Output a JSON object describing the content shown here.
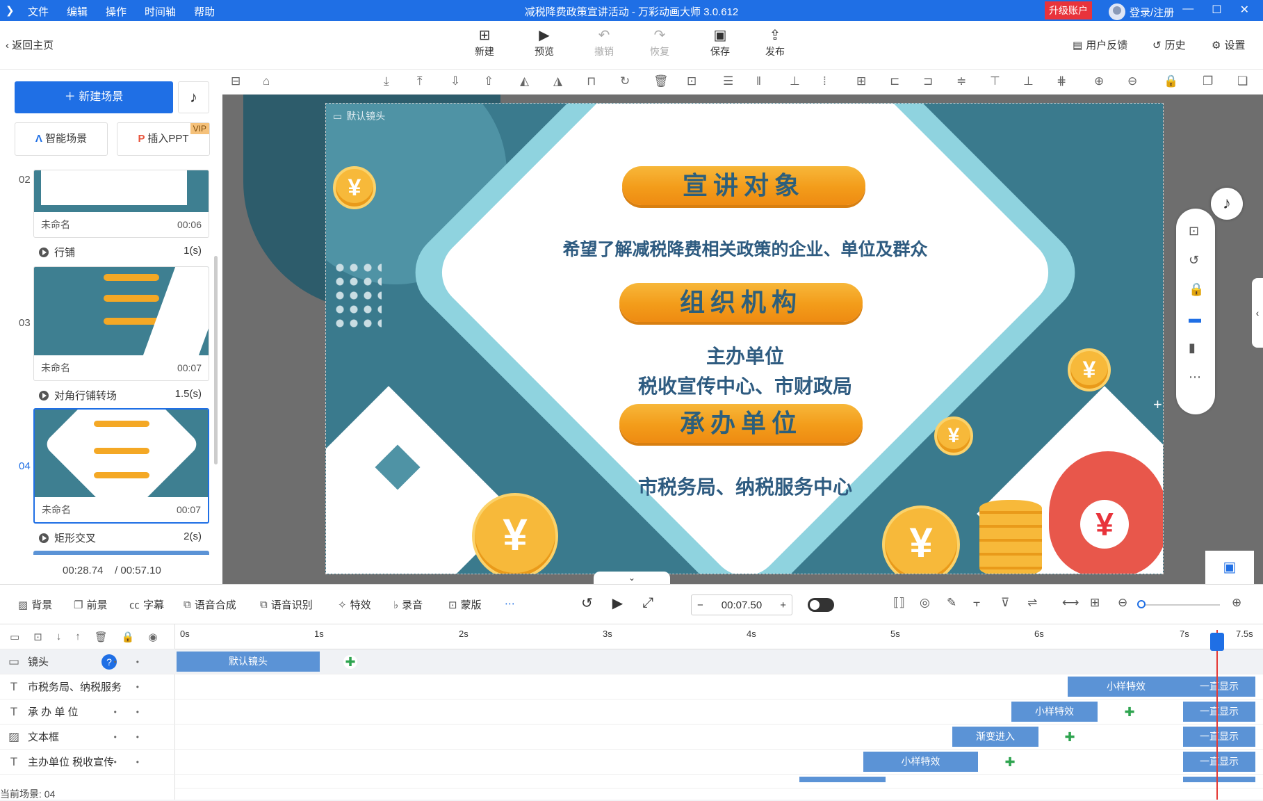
{
  "titlebar": {
    "menus": [
      "文件",
      "编辑",
      "操作",
      "时间轴",
      "帮助"
    ],
    "title": "减税降费政策宣讲活动 - 万彩动画大师 3.0.612",
    "upgrade": "升级账户",
    "login": "登录/注册"
  },
  "toolbar": {
    "back": "返回主页",
    "new": "新建",
    "preview": "预览",
    "undo": "撤销",
    "redo": "恢复",
    "save": "保存",
    "publish": "发布",
    "feedback": "用户反馈",
    "history": "历史",
    "settings": "设置"
  },
  "leftpanel": {
    "new_scene": "新建场景",
    "smart_scene": "智能场景",
    "insert_ppt": "插入PPT",
    "vip": "VIP",
    "scenes": [
      {
        "num": "02",
        "name": "未命名",
        "time": "00:06"
      },
      {
        "num": "03",
        "name": "未命名",
        "time": "00:07"
      },
      {
        "num": "04",
        "name": "未命名",
        "time": "00:07"
      }
    ],
    "transitions": [
      {
        "name": "行铺",
        "dur": "1(s)"
      },
      {
        "name": "对角行铺转场",
        "dur": "1.5(s)"
      },
      {
        "name": "矩形交叉",
        "dur": "2(s)"
      }
    ],
    "time_current": "00:28.74",
    "time_total": "/ 00:57.10"
  },
  "stage": {
    "camera_label": "默认镜头",
    "heading1": "宣讲对象",
    "text1": "希望了解减税降费相关政策的企业、单位及群众",
    "heading2": "组织机构",
    "text2a": "主办单位",
    "text2b": "税收宣传中心、市财政局",
    "heading3": "承办单位",
    "text3": "市税务局、纳税服务中心",
    "coin_symbol": "¥"
  },
  "timeline_bar": {
    "bg": "背景",
    "fg": "前景",
    "subtitle": "字幕",
    "tts": "语音合成",
    "asr": "语音识别",
    "fx": "特效",
    "record": "录音",
    "mask": "蒙版",
    "time": "00:07.50"
  },
  "tracks": {
    "ruler": [
      "0s",
      "1s",
      "2s",
      "3s",
      "4s",
      "5s",
      "6s",
      "7s",
      "7.5s"
    ],
    "rows": [
      {
        "name": "镜头",
        "clip": "默认镜头"
      },
      {
        "name": "市税务局、纳税服务",
        "clip": "小样特效",
        "end": "一直显示"
      },
      {
        "name": "承 办 单 位",
        "clip": "小样特效",
        "end": "一直显示"
      },
      {
        "name": "文本框",
        "clip": "渐变进入",
        "end": "一直显示"
      },
      {
        "name": "主办单位 税收宣传",
        "clip": "小样特效",
        "end": "一直显示"
      }
    ],
    "status": "当前场景: 04"
  },
  "colors": {
    "accent": "#1f6fe5",
    "upgrade": "#e8333b",
    "clip": "#5b93d6",
    "stage": "#3a7a8d"
  }
}
